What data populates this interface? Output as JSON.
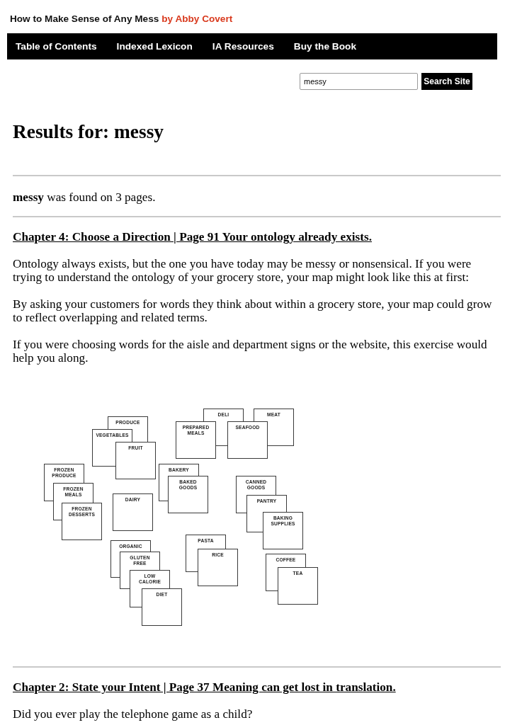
{
  "site": {
    "title": "How to Make Sense of Any Mess",
    "byline": "by Abby Covert"
  },
  "nav": [
    "Table of Contents",
    "Indexed Lexicon",
    "IA Resources",
    "Buy the Book"
  ],
  "search": {
    "value": "messy",
    "button": "Search Site"
  },
  "heading": "Results for: messy",
  "summary": "**messy** was found on 3 pages.",
  "results": [
    {
      "link": "Chapter 4: Choose a Direction | Page 91 Your ontology already exists.",
      "paragraphs": [
        "Ontology always exists, but the one you have today may be messy or nonsensical. If you were trying to understand the ontology of your grocery store, your map might look like this at first:",
        "By asking your customers for words they think about within a grocery store, your map could grow to reflect overlapping and related terms.",
        "If you were choosing words for the aisle and department signs or the website, this exercise would help you along."
      ],
      "figure": {
        "clusters": [
          {
            "cards": [
              "PRODUCE",
              "VEGETABLES",
              "FRUIT"
            ]
          },
          {
            "cards": [
              "DELI",
              "MEAT",
              "PREPARED MEALS",
              "SEAFOOD"
            ]
          },
          {
            "cards": [
              "FROZEN PRODUCE",
              "FROZEN MEALS",
              "FROZEN DESSERTS"
            ]
          },
          {
            "cards": [
              "BAKERY",
              "BAKED GOODS"
            ]
          },
          {
            "cards": [
              "DAIRY"
            ]
          },
          {
            "cards": [
              "CANNED GOODS",
              "PANTRY",
              "BAKING SUPPLIES"
            ]
          },
          {
            "cards": [
              "ORGANIC",
              "GLUTEN FREE",
              "LOW CALORIE",
              "DIET"
            ]
          },
          {
            "cards": [
              "PASTA",
              "RICE"
            ]
          },
          {
            "cards": [
              "COFFEE",
              "TEA"
            ]
          }
        ]
      }
    },
    {
      "link": "Chapter 2: State your Intent | Page 37 Meaning can get lost in translation.",
      "paragraphs": [
        "Did you ever play the telephone game as a child?"
      ]
    }
  ]
}
